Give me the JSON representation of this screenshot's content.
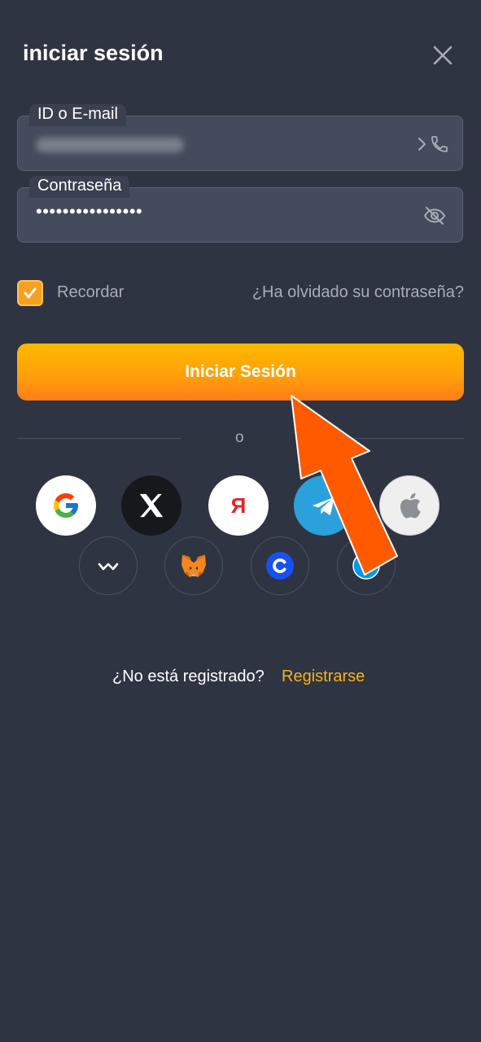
{
  "header": {
    "title": "iniciar sesión",
    "close_icon": "close-icon"
  },
  "form": {
    "id_label": "ID o E-mail",
    "id_value_hidden": true,
    "password_label": "Contraseña",
    "password_value": "••••••••••••••••",
    "remember_label": "Recordar",
    "remember_checked": true,
    "forgot_link": "¿Ha olvidado su contraseña?",
    "submit_label": "Iniciar Sesión"
  },
  "divider_text": "o",
  "social_row_1": [
    "google-icon",
    "x-icon",
    "yandex-icon",
    "telegram-icon",
    "apple-icon"
  ],
  "social_row_2": [
    "walletconnect-icon",
    "metamask-icon",
    "coinbase-icon",
    "ton-icon"
  ],
  "footer": {
    "question": "¿No está registrado?",
    "register_link": "Registrarse"
  },
  "colors": {
    "background": "#2f3443",
    "field": "#434b5c",
    "accent": "#ffa10a",
    "link": "#f3b21f",
    "annotation_arrow": "#ff5a00"
  }
}
